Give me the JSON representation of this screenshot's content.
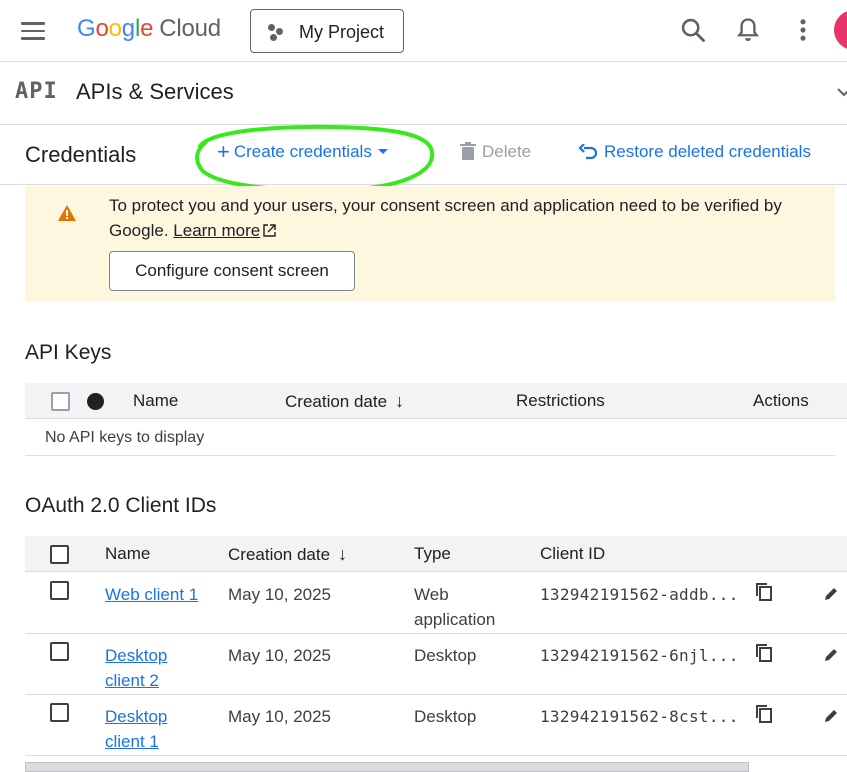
{
  "header": {
    "logo_letters": [
      "G",
      "o",
      "o",
      "g",
      "l",
      "e"
    ],
    "logo_cloud": "Cloud",
    "project_name": "My Project",
    "icons": [
      "menu-icon",
      "search-icon",
      "bell-icon",
      "more-vert-icon",
      "avatar"
    ]
  },
  "api_header": {
    "glyph": "API",
    "title": "APIs & Services"
  },
  "toolbar": {
    "title": "Credentials",
    "create_label": "Create credentials",
    "delete_label": "Delete",
    "restore_label": "Restore deleted credentials"
  },
  "banner": {
    "text": "To protect you and your users, your consent screen and application need to be verified by Google.",
    "learn_more": "Learn more",
    "button": "Configure consent screen"
  },
  "api_keys": {
    "title": "API Keys",
    "columns": [
      "Name",
      "Creation date",
      "Restrictions",
      "Actions"
    ],
    "empty_text": "No API keys to display"
  },
  "oauth": {
    "title": "OAuth 2.0 Client IDs",
    "columns": [
      "Name",
      "Creation date",
      "Type",
      "Client ID"
    ],
    "rows": [
      {
        "name": "Web client 1",
        "date": "May 10, 2025",
        "type": "Web application",
        "client_id": "132942191562-addb..."
      },
      {
        "name": "Desktop client 2",
        "date": "May 10, 2025",
        "type": "Desktop",
        "client_id": "132942191562-6njl..."
      },
      {
        "name": "Desktop client 1",
        "date": "May 10, 2025",
        "type": "Desktop",
        "client_id": "132942191562-8cst..."
      }
    ]
  },
  "colors": {
    "accent": "#1a73e8",
    "banner_bg": "#fef7e0",
    "warning": "#e37400",
    "highlight_annotation": "#39e81c"
  }
}
